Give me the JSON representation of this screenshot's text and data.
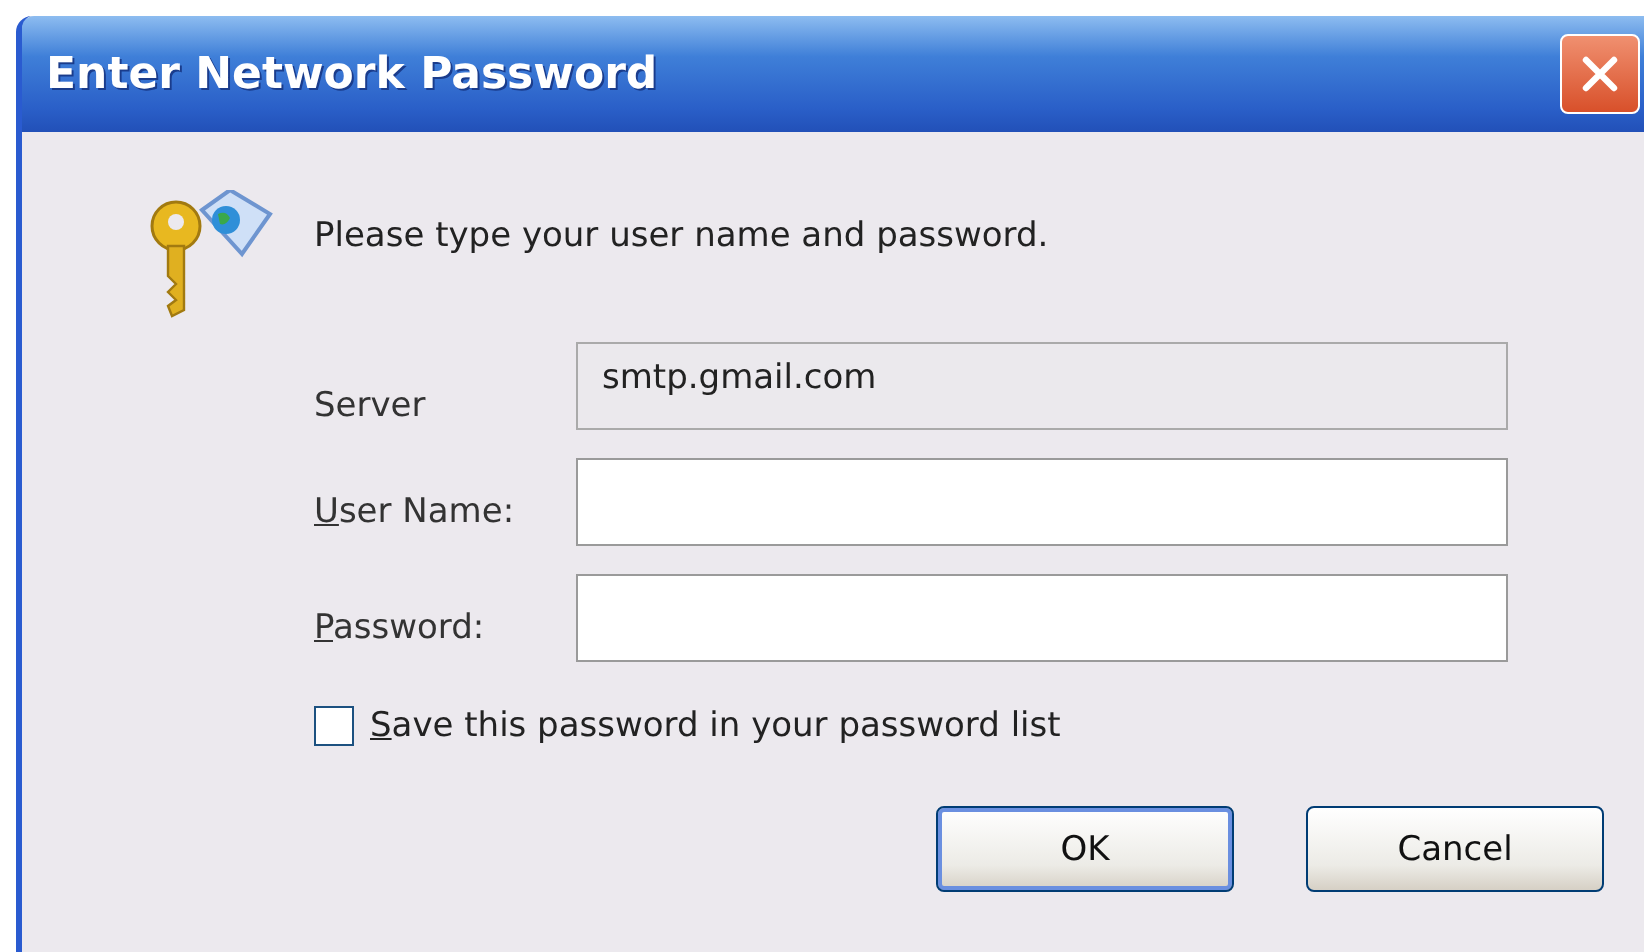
{
  "window": {
    "title": "Enter Network Password"
  },
  "message": "Please type your user name and password.",
  "fields": [
    {
      "label": "Server",
      "mnemonic_underlined": false,
      "value": "smtp.gmail.com",
      "disabled": true
    },
    {
      "label": "User Name:",
      "mnemonic_underlined": true,
      "disabled": false
    },
    {
      "label": "Password:",
      "mnemonic_underlined": true,
      "disabled": false
    }
  ],
  "save_checkbox": {
    "label": "Save this password in your password list",
    "mnemonic_underlined": true,
    "checked": false
  },
  "buttons": [
    {
      "label": "OK",
      "default": true
    },
    {
      "label": "Cancel",
      "default": false
    }
  ]
}
